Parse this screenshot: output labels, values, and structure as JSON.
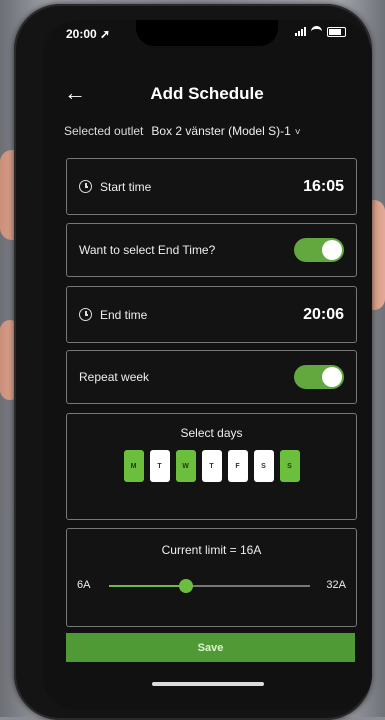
{
  "status_bar": {
    "time": "20:00 ➚"
  },
  "header": {
    "title": "Add Schedule",
    "back_icon": "arrow-left-icon"
  },
  "outlet": {
    "label": "Selected outlet",
    "value": "Box 2 vänster (Model S)-1"
  },
  "start_time": {
    "label": "Start time",
    "value": "16:05"
  },
  "end_time_toggle": {
    "label": "Want to select End Time?",
    "enabled": true
  },
  "end_time": {
    "label": "End time",
    "value": "20:06"
  },
  "repeat_week": {
    "label": "Repeat week",
    "enabled": true
  },
  "days": {
    "title": "Select days",
    "items": [
      {
        "letter": "M",
        "selected": true
      },
      {
        "letter": "T",
        "selected": false
      },
      {
        "letter": "W",
        "selected": true
      },
      {
        "letter": "T",
        "selected": false
      },
      {
        "letter": "F",
        "selected": false
      },
      {
        "letter": "S",
        "selected": false
      },
      {
        "letter": "S",
        "selected": true
      }
    ]
  },
  "current_limit": {
    "label": "Current limit = 16A",
    "min_label": "6A",
    "max_label": "32A",
    "min": 6,
    "max": 32,
    "value": 16
  },
  "save_button": {
    "label": "Save"
  },
  "colors": {
    "accent": "#6cbf3c",
    "background": "#111111"
  }
}
